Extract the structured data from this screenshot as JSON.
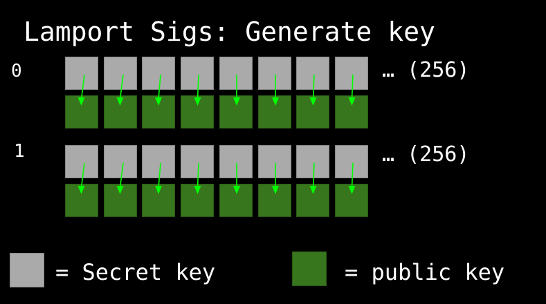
{
  "title": "Lamport Sigs: Generate key",
  "rows": [
    {
      "label": "0",
      "suffix": "… (256)",
      "cells": 8
    },
    {
      "label": "1",
      "suffix": "… (256)",
      "cells": 8
    }
  ],
  "legend": {
    "secret_label": "= Secret key",
    "public_label": "= public key"
  },
  "colors": {
    "background": "#000000",
    "secret": "#aaaaaa",
    "public": "#38761d",
    "arrow": "#00ff00",
    "text": "#ffffff"
  }
}
